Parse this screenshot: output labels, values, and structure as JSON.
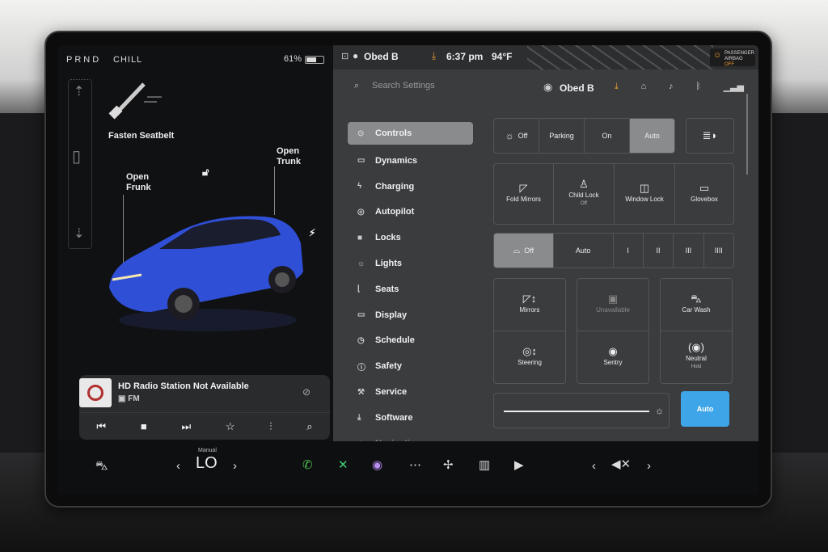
{
  "status_left": {
    "gears": "PRND",
    "mode": "CHILL",
    "battery": "61%"
  },
  "car_panel": {
    "seatbelt": "Fasten Seatbelt",
    "frunk": [
      "Open",
      "Frunk"
    ],
    "trunk": [
      "Open",
      "Trunk"
    ]
  },
  "media": {
    "station": "HD Radio Station Not Available",
    "source": "FM",
    "controls": [
      "prev",
      "stop",
      "next",
      "favorite",
      "equalizer",
      "search"
    ]
  },
  "status_right": {
    "user": "Obed B",
    "time": "6:37 pm",
    "temp": "94°F",
    "airbag_line1": "PASSENGER",
    "airbag_line2": "AIRBAG",
    "airbag_state": "OFF"
  },
  "settings_header": {
    "search_placeholder": "Search Settings",
    "user": "Obed B"
  },
  "menu": [
    {
      "label": "Controls",
      "icon": "toggle-icon"
    },
    {
      "label": "Dynamics",
      "icon": "car-icon"
    },
    {
      "label": "Charging",
      "icon": "bolt-icon"
    },
    {
      "label": "Autopilot",
      "icon": "steering-icon"
    },
    {
      "label": "Locks",
      "icon": "lock-icon"
    },
    {
      "label": "Lights",
      "icon": "sun-icon"
    },
    {
      "label": "Seats",
      "icon": "seat-icon"
    },
    {
      "label": "Display",
      "icon": "display-icon"
    },
    {
      "label": "Schedule",
      "icon": "clock-icon"
    },
    {
      "label": "Safety",
      "icon": "alert-icon"
    },
    {
      "label": "Service",
      "icon": "wrench-icon"
    },
    {
      "label": "Software",
      "icon": "download-icon"
    },
    {
      "label": "Navigation",
      "icon": "navigation-icon"
    }
  ],
  "headlights": {
    "options": [
      "Off",
      "Parking",
      "On",
      "Auto"
    ],
    "selected": "Auto"
  },
  "quick_tiles": [
    {
      "label": "Fold Mirrors",
      "sub": ""
    },
    {
      "label": "Child Lock",
      "sub": "Off"
    },
    {
      "label": "Window Lock",
      "sub": ""
    },
    {
      "label": "Glovebox",
      "sub": ""
    }
  ],
  "wipers": {
    "options": [
      "Off",
      "Auto",
      "I",
      "II",
      "III",
      "IIII"
    ],
    "selected": "Off"
  },
  "adjust_tiles": [
    {
      "label": "Mirrors",
      "sub": ""
    },
    {
      "label": "Unavailable",
      "sub": ""
    },
    {
      "label": "Car Wash",
      "sub": ""
    },
    {
      "label": "Steering",
      "sub": ""
    },
    {
      "label": "Sentry",
      "sub": ""
    },
    {
      "label": "Neutral",
      "sub": "Hold"
    }
  ],
  "brightness": {
    "auto_label": "Auto",
    "level": 1.0
  },
  "dock": {
    "temp_mode": "Manual",
    "temp": "LO"
  },
  "colors": {
    "accent": "#3ea6e8",
    "warning": "#f0a030",
    "car": "#2f4fd6"
  }
}
